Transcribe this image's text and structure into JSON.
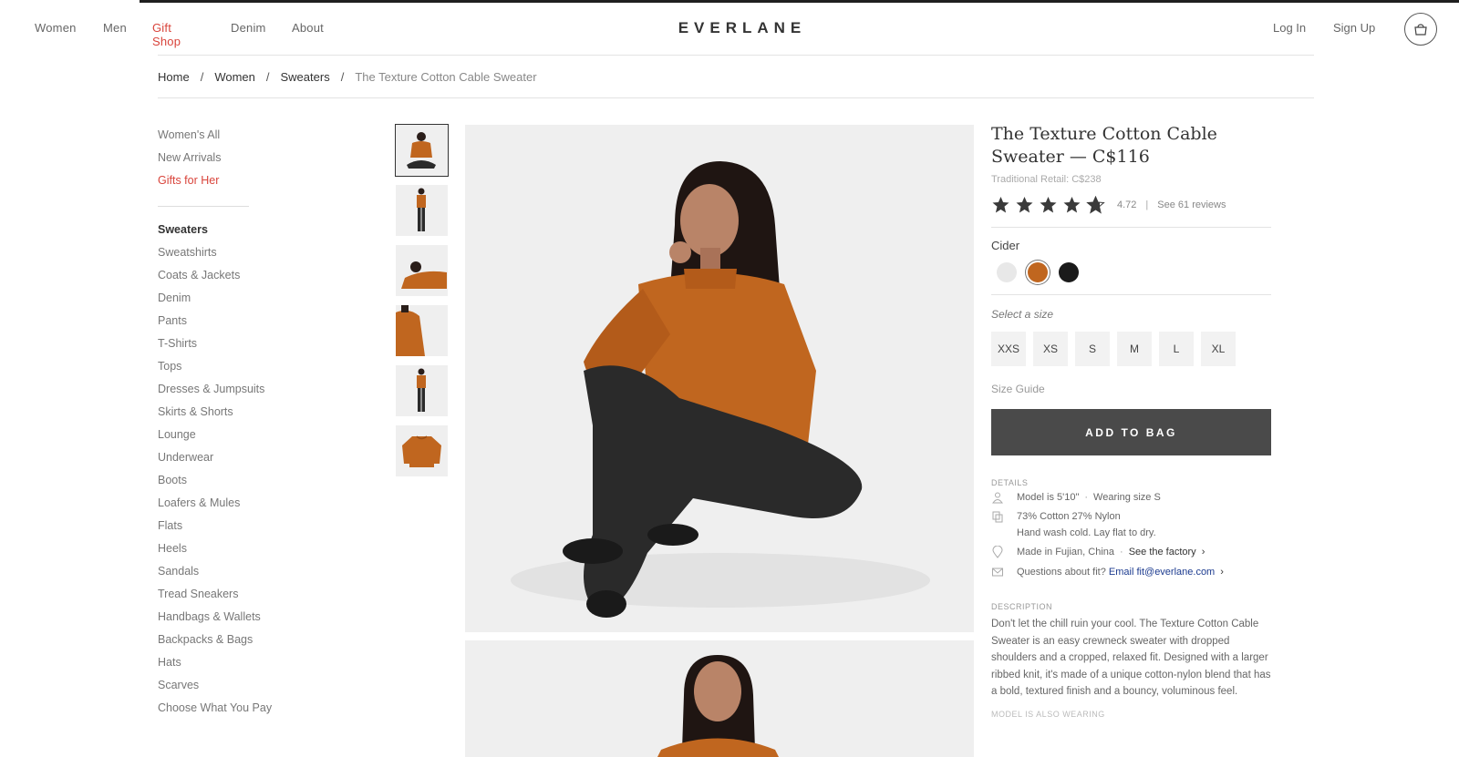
{
  "header": {
    "nav": [
      "Women",
      "Men",
      "Gift Shop",
      "Denim",
      "About"
    ],
    "active_nav": "Gift Shop",
    "logo": "EVERLANE",
    "login": "Log In",
    "signup": "Sign Up",
    "bag_icon": "shopping-bag-icon"
  },
  "breadcrumb": {
    "items": [
      "Home",
      "Women",
      "Sweaters"
    ],
    "separator": "/",
    "current": "The Texture Cotton Cable Sweater"
  },
  "sidebar": {
    "top": [
      "Women's All",
      "New Arrivals",
      "Gifts for Her"
    ],
    "categories": [
      "Sweaters",
      "Sweatshirts",
      "Coats & Jackets",
      "Denim",
      "Pants",
      "T-Shirts",
      "Tops",
      "Dresses & Jumpsuits",
      "Skirts & Shorts",
      "Lounge",
      "Underwear",
      "Boots",
      "Loafers & Mules",
      "Flats",
      "Heels",
      "Sandals",
      "Tread Sneakers",
      "Handbags & Wallets",
      "Backpacks & Bags",
      "Hats",
      "Scarves",
      "Choose What You Pay"
    ]
  },
  "product": {
    "title_line1": "The Texture Cotton Cable",
    "title_line2": "Sweater — C$116",
    "retail": "Traditional Retail: C$238",
    "rating": "4.72",
    "rating_value": 4.72,
    "rating_sep": "|",
    "reviews": "See 61 reviews",
    "color_name": "Cider",
    "colors": [
      "#e8e8e8",
      "#c0661f",
      "#1a1a1a"
    ],
    "selected_color_index": 1,
    "size_prompt": "Select a size",
    "sizes": [
      "XXS",
      "XS",
      "S",
      "M",
      "L",
      "XL"
    ],
    "size_guide": "Size Guide",
    "add_to_bag": "ADD TO BAG",
    "accent_color": "#c0661f"
  },
  "details": {
    "heading": "DETAILS",
    "model_text": "Model is 5'10\"",
    "model_dot": "·",
    "model_size": "Wearing size S",
    "fabric": "73% Cotton 27% Nylon",
    "care": "Hand wash cold. Lay flat to dry.",
    "made_in": "Made in Fujian, China",
    "factory_dot": "·",
    "factory_link": "See the factory",
    "fit_question": "Questions about fit?",
    "fit_link": "Email fit@everlane.com"
  },
  "description": {
    "heading": "DESCRIPTION",
    "text": "Don't let the chill ruin your cool. The Texture Cotton Cable Sweater is an easy crewneck sweater with dropped shoulders and a cropped, relaxed fit. Designed with a larger ribbed knit, it's made of a unique cotton-nylon blend that has a bold, textured finish and a bouncy, voluminous feel.",
    "next_heading": "MODEL IS ALSO WEARING"
  }
}
